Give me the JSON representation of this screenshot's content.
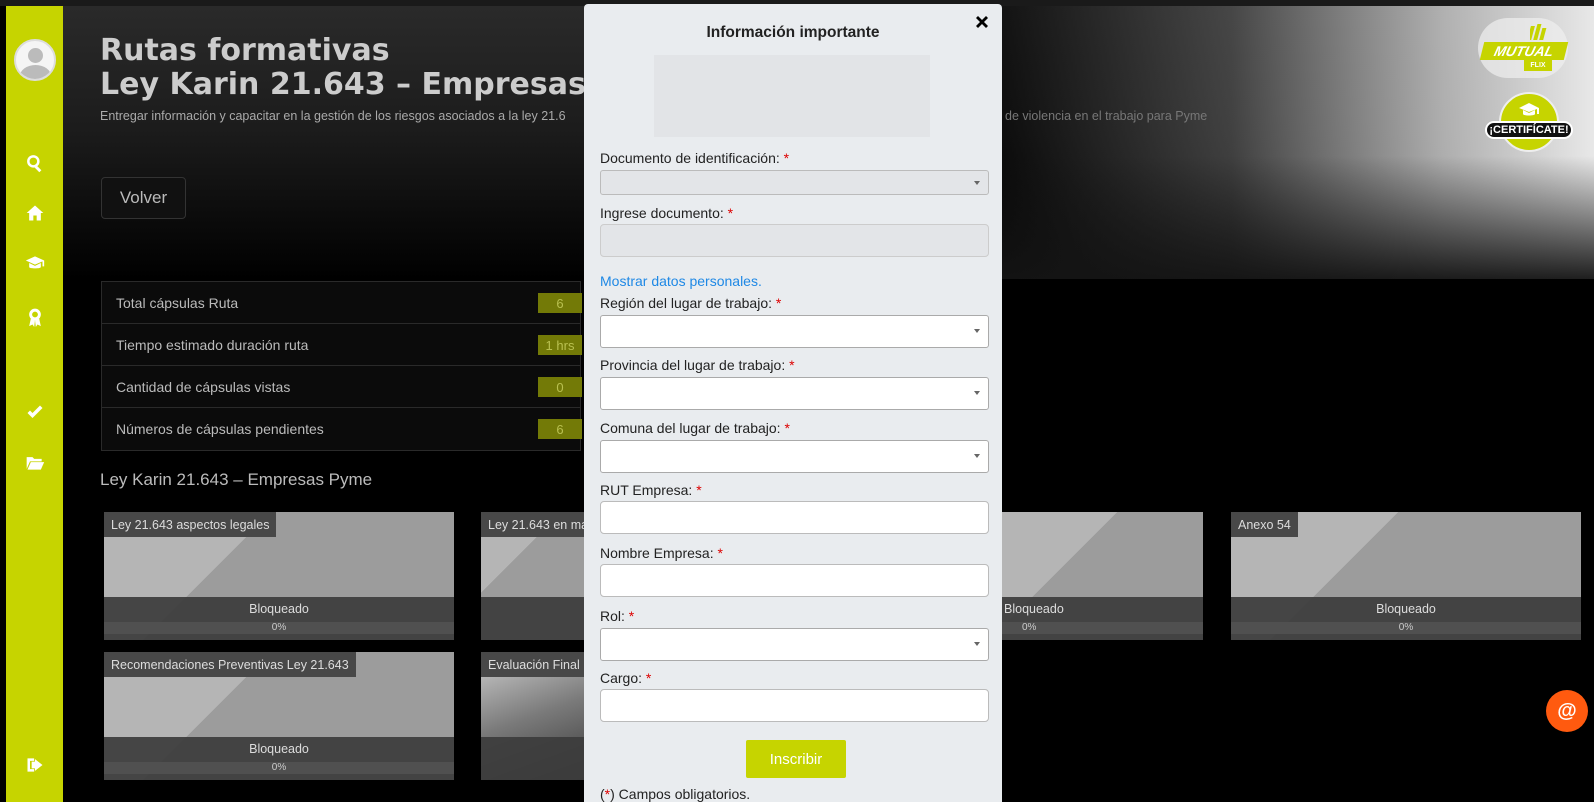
{
  "hero": {
    "title_line1": "Rutas formativas",
    "title_line2": "Ley Karin 21.643 – Empresas",
    "description": "Entregar información y capacitar en la gestión de los riesgos asociados a la ley 21.6",
    "description_right": "de violencia en el trabajo para Pyme",
    "back_label": "Volver"
  },
  "stats": [
    {
      "label": "Total cápsulas Ruta",
      "value": "6"
    },
    {
      "label": "Tiempo estimado duración ruta",
      "value": "1 hrs"
    },
    {
      "label": "Cantidad de cápsulas vistas",
      "value": "0"
    },
    {
      "label": "Números de cápsulas pendientes",
      "value": "6"
    }
  ],
  "section_title": "Ley Karin 21.643 – Empresas Pyme",
  "cards": [
    {
      "tag": "Ley 21.643 aspectos legales",
      "status": "Bloqueado",
      "progress": "0%"
    },
    {
      "tag": "Ley 21.643 en ma",
      "status": "",
      "progress": ""
    },
    {
      "tag": "",
      "status": "Bloqueado",
      "progress": "0%"
    },
    {
      "tag": "Anexo 54",
      "status": "Bloqueado",
      "progress": "0%"
    },
    {
      "tag": "Recomendaciones Preventivas Ley 21.643",
      "status": "Bloqueado",
      "progress": "0%"
    },
    {
      "tag": "Evaluación Final",
      "status": "",
      "progress": ""
    }
  ],
  "brand": {
    "logo_word": "MUTUAL",
    "logo_sub": "FLIX",
    "cert_label": "¡CERTIFÍCATE!",
    "chat_symbol": "@",
    "accent": "#c6d400"
  },
  "modal": {
    "title": "Información importante",
    "doc_label": "Documento de identificación:",
    "doc_input_label": "Ingrese documento:",
    "show_personal": "Mostrar datos personales.",
    "region_label": "Región del lugar de trabajo:",
    "provincia_label": "Provincia del lugar de trabajo:",
    "comuna_label": "Comuna del lugar de trabajo:",
    "rut_label": "RUT Empresa:",
    "nombre_label": "Nombre Empresa:",
    "rol_label": "Rol:",
    "cargo_label": "Cargo:",
    "required_mark": "*",
    "submit_label": "Inscribir",
    "footnote_open": "(",
    "footnote_close": ") Campos obligatorios."
  }
}
